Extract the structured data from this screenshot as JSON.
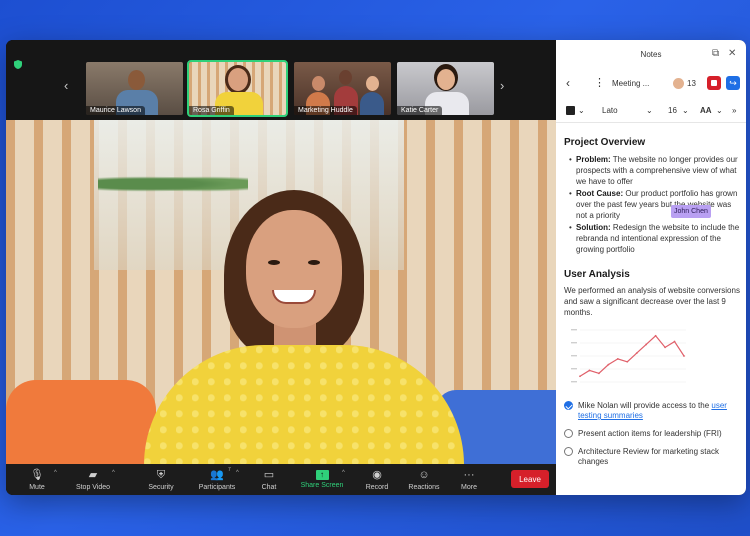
{
  "participants": [
    {
      "name": "Maurice Lawson",
      "bg": "#7a6a5a",
      "skin": "#8a5a3a",
      "shirt": "#5a7fa8"
    },
    {
      "name": "Rosa Griffin",
      "bg": "#cdb89b",
      "skin": "#d9a07f",
      "shirt": "#f1d23b"
    },
    {
      "name": "Marketing Huddle",
      "bg": "#6b4a3a",
      "skin": "#c98a6a",
      "shirt": "#a33c3c"
    },
    {
      "name": "Katie Carter",
      "bg": "#b9b9bd",
      "skin": "#e3b290",
      "shirt": "#e9e9ee"
    }
  ],
  "controls": {
    "mute": "Mute",
    "stop_video": "Stop Video",
    "security": "Security",
    "participants": "Participants",
    "participant_count": "7",
    "chat": "Chat",
    "share_screen": "Share Screen",
    "record": "Record",
    "reactions": "Reactions",
    "more": "More",
    "leave": "Leave"
  },
  "notes": {
    "title": "Notes",
    "doc_title": "Meeting ...",
    "attendee_count": "13",
    "font": "Lato",
    "font_size": "16",
    "text_style": "AA",
    "section1_title": "Project Overview",
    "problem_label": "Problem:",
    "problem_text": " The website no longer provides our prospects with a comprehensive view of what we have to offer",
    "cursor_name": "John Chen",
    "root_label": "Root Cause:",
    "root_text": " Our product portfolio has grown over the past few years but the website was not a priority",
    "solution_label": "Solution:",
    "solution_text": " Redesign the website to include the rebranda nd intentional expression of the growing portfolio",
    "section2_title": "User Analysis",
    "analysis_text": "We performed an analysis of website conversions and saw a significant decrease over the last 9 months.",
    "todo1_text": "Mike Nolan will provide access to the ",
    "todo1_link": "user testing summaries",
    "todo2_text": "Present action items for leadership (FRI)",
    "todo3_text": "Architecture Review for marketing stack changes"
  },
  "chart_data": {
    "type": "line",
    "x": [
      1,
      2,
      3,
      4,
      5,
      6,
      7,
      8,
      9,
      10,
      11,
      12
    ],
    "values": [
      2,
      4,
      3,
      6,
      8,
      7,
      10,
      13,
      16,
      12,
      14,
      9
    ],
    "series_color": "#e0606a",
    "ylim": [
      0,
      18
    ]
  },
  "colors": {
    "accent_blue": "#1f6fe5",
    "leave_red": "#d6202a",
    "active_green": "#2fd07a"
  }
}
